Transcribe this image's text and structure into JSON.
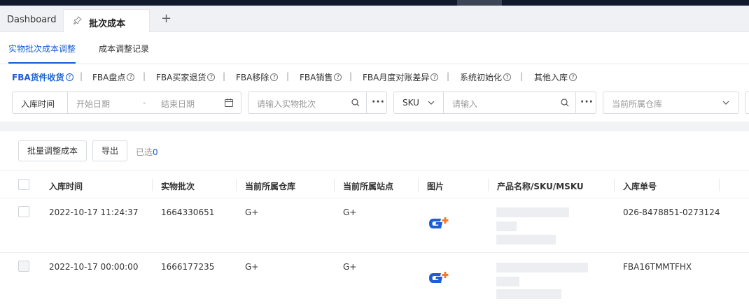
{
  "tabs": {
    "dashboard": "Dashboard",
    "active": "批次成本",
    "add": "+"
  },
  "subtabs": {
    "first": "实物批次成本调整",
    "second": "成本调整记录"
  },
  "categories": [
    {
      "label": "FBA货件收货",
      "active": true
    },
    {
      "label": "FBA盘点",
      "active": false
    },
    {
      "label": "FBA买家退货",
      "active": false
    },
    {
      "label": "FBA移除",
      "active": false
    },
    {
      "label": "FBA销售",
      "active": false
    },
    {
      "label": "FBA月度对账差异",
      "active": false
    },
    {
      "label": "系统初始化",
      "active": false
    },
    {
      "label": "其他入库",
      "active": false
    }
  ],
  "filters": {
    "date_label": "入库时间",
    "start_placeholder": "开始日期",
    "range_sep": "-",
    "end_placeholder": "结束日期",
    "batch_placeholder": "请输入实物批次",
    "sku_select": "SKU",
    "sku_placeholder": "请输入",
    "warehouse_placeholder": "当前所属仓库",
    "more": "···"
  },
  "toolbar": {
    "batch_adjust": "批量调整成本",
    "export": "导出",
    "selected_label": "已选",
    "selected_count": "0"
  },
  "table": {
    "columns": [
      "入库时间",
      "实物批次",
      "当前所属仓库",
      "当前所属站点",
      "图片",
      "产品名称/SKU/MSKU",
      "入库单号"
    ],
    "rows": [
      {
        "time": "2022-10-17 11:24:37",
        "batch": "1664330651",
        "warehouse": "G+",
        "site": "G+",
        "order": "026-8478851-0273124"
      },
      {
        "time": "2022-10-17 00:00:00",
        "batch": "1666177235",
        "warehouse": "G+",
        "site": "G+",
        "order": "FBA16TMMTFHX"
      }
    ]
  },
  "colors": {
    "accent": "#1a5fd6",
    "logo_blue": "#1a5fd6",
    "logo_orange": "#f07c2b"
  }
}
